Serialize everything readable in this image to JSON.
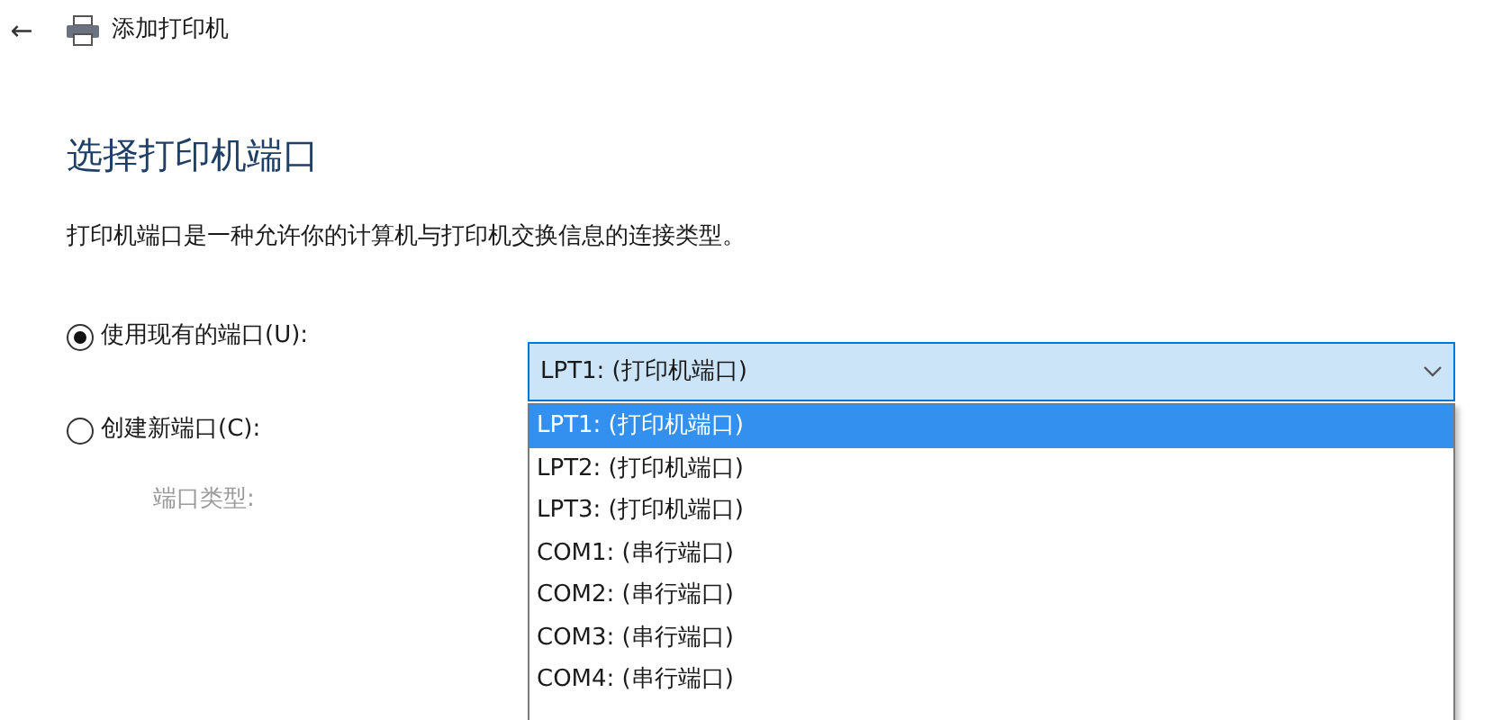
{
  "window": {
    "back": "←",
    "title": "添加打印机"
  },
  "heading": "选择打印机端口",
  "description": "打印机端口是一种允许你的计算机与打印机交换信息的连接类型。",
  "options": [
    {
      "label": "使用现有的端口(U):",
      "selected": true
    },
    {
      "label": "创建新端口(C):",
      "selected": false
    }
  ],
  "port_type_label": "端口类型:",
  "port_combo": {
    "value": "LPT1: (打印机端口)",
    "expanded": true
  },
  "port_list": [
    {
      "label": "LPT1: (打印机端口)",
      "selected": true
    },
    {
      "label": "LPT2: (打印机端口)",
      "selected": false
    },
    {
      "label": "LPT3: (打印机端口)",
      "selected": false
    },
    {
      "label": "COM1: (串行端口)",
      "selected": false
    },
    {
      "label": "COM2: (串行端口)",
      "selected": false
    },
    {
      "label": "COM3: (串行端口)",
      "selected": false
    },
    {
      "label": "COM4: (串行端口)",
      "selected": false
    }
  ]
}
